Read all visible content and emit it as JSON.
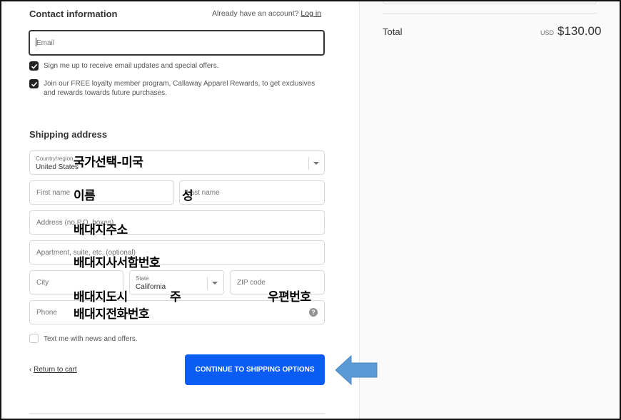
{
  "contact": {
    "heading": "Contact information",
    "have_account": "Already have an account?",
    "login_link": "Log in",
    "email_placeholder": "Email",
    "email_updates": "Sign me up to receive email updates and special offers.",
    "loyalty_line1": "Join our FREE loyalty member program, Callaway Apparel Rewards, to get exclusives",
    "loyalty_line2": "and rewards towards future purchases."
  },
  "shipping": {
    "heading": "Shipping address",
    "country_label": "Country/region",
    "country_value": "United States",
    "first_name_placeholder": "First name",
    "last_name_placeholder": "Last name",
    "address_placeholder": "Address (no P.O. boxes)",
    "apartment_placeholder": "Apartment, suite, etc. (optional)",
    "city_placeholder": "City",
    "state_label": "State",
    "state_value": "California",
    "zip_placeholder": "ZIP code",
    "phone_placeholder": "Phone",
    "help_glyph": "?",
    "text_me": "Text me with news and offers."
  },
  "footer": {
    "return_chevron": "‹",
    "return_label": "Return to cart",
    "continue_label": "CONTINUE TO SHIPPING OPTIONS"
  },
  "summary": {
    "total_label": "Total",
    "currency": "USD",
    "total_amount": "$130.00"
  },
  "annotations": {
    "country": "국가선택-미국",
    "first_name": "이름",
    "last_name": "성",
    "address": "배대지주소",
    "apartment": "배대지사서함번호",
    "city": "배대지도시",
    "state": "주",
    "zip": "우편번호",
    "phone": "배대지전화번호"
  },
  "colors": {
    "accent": "#0a5cf5",
    "arrow": "#5b9bd5",
    "checkbox": "#222222"
  },
  "icons": {
    "check": "check-icon",
    "chevron_down": "chevron-down-icon",
    "help": "help-icon",
    "arrow": "left-arrow-icon"
  }
}
